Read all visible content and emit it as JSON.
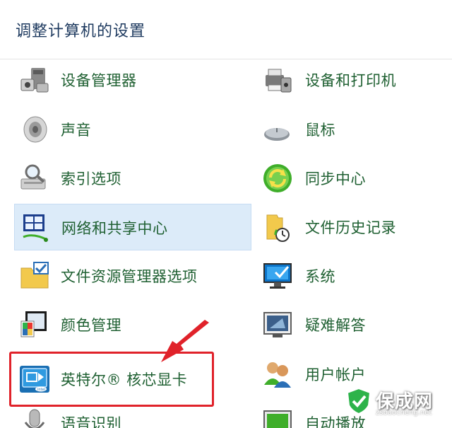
{
  "header": {
    "title": "调整计算机的设置"
  },
  "items": [
    {
      "label": "设备管理器",
      "icon": "device-manager-icon"
    },
    {
      "label": "设备和打印机",
      "icon": "printer-icon"
    },
    {
      "label": "声音",
      "icon": "speaker-icon"
    },
    {
      "label": "鼠标",
      "icon": "mouse-icon"
    },
    {
      "label": "索引选项",
      "icon": "indexing-icon"
    },
    {
      "label": "同步中心",
      "icon": "sync-icon"
    },
    {
      "label": "网络和共享中心",
      "icon": "network-icon"
    },
    {
      "label": "文件历史记录",
      "icon": "file-history-icon"
    },
    {
      "label": "文件资源管理器选项",
      "icon": "folder-options-icon"
    },
    {
      "label": "系统",
      "icon": "system-monitor-icon"
    },
    {
      "label": "颜色管理",
      "icon": "color-management-icon"
    },
    {
      "label": "疑难解答",
      "icon": "troubleshooting-icon"
    },
    {
      "label": "英特尔® 核芯显卡",
      "icon": "intel-graphics-icon"
    },
    {
      "label": "用户帐户",
      "icon": "user-accounts-icon"
    },
    {
      "label": "语音识别",
      "icon": "microphone-icon"
    },
    {
      "label": "自动播放",
      "icon": "autoplay-icon"
    }
  ],
  "watermark": {
    "text": "保成网",
    "sub": "zsbaocheng.net"
  },
  "colors": {
    "link_text": "#1f6032",
    "highlight": "#e0222a",
    "selected_bg": "#dcebf9"
  }
}
